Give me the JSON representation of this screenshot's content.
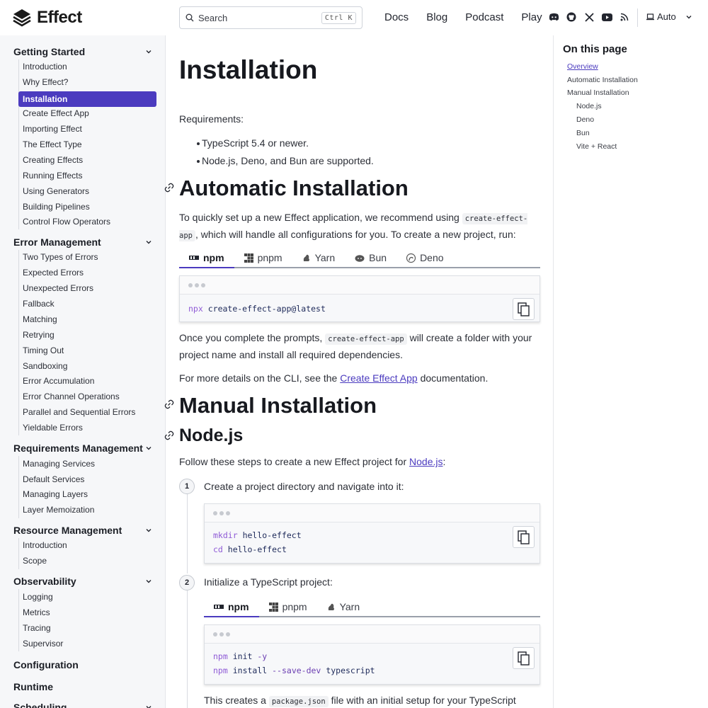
{
  "header": {
    "logo_text": "Effect",
    "search_placeholder": "Search",
    "search_shortcut": "Ctrl K",
    "nav": [
      "Docs",
      "Blog",
      "Podcast",
      "Play"
    ],
    "social_icons": [
      "discord-icon",
      "github-icon",
      "x-icon",
      "youtube-icon",
      "rss-icon"
    ],
    "theme_label": "Auto"
  },
  "sidebar": {
    "groups": [
      {
        "title": "Getting Started",
        "items": [
          "Introduction",
          "Why Effect?",
          "Installation",
          "Create Effect App",
          "Importing Effect",
          "The Effect Type",
          "Creating Effects",
          "Running Effects",
          "Using Generators",
          "Building Pipelines",
          "Control Flow Operators"
        ]
      },
      {
        "title": "Error Management",
        "items": [
          "Two Types of Errors",
          "Expected Errors",
          "Unexpected Errors",
          "Fallback",
          "Matching",
          "Retrying",
          "Timing Out",
          "Sandboxing",
          "Error Accumulation",
          "Error Channel Operations",
          "Parallel and Sequential Errors",
          "Yieldable Errors"
        ]
      },
      {
        "title": "Requirements Management",
        "items": [
          "Managing Services",
          "Default Services",
          "Managing Layers",
          "Layer Memoization"
        ]
      },
      {
        "title": "Resource Management",
        "items": [
          "Introduction",
          "Scope"
        ]
      },
      {
        "title": "Observability",
        "items": [
          "Logging",
          "Metrics",
          "Tracing",
          "Supervisor"
        ]
      },
      {
        "title": "Configuration",
        "items": []
      },
      {
        "title": "Runtime",
        "items": []
      },
      {
        "title": "Scheduling",
        "items": []
      }
    ],
    "active_item": "Installation"
  },
  "main": {
    "title": "Installation",
    "requirements_label": "Requirements:",
    "requirements": [
      "TypeScript 5.4 or newer.",
      "Node.js, Deno, and Bun are supported."
    ],
    "auto_heading": "Automatic Installation",
    "auto_p1_a": "To quickly set up a new Effect application, we recommend using",
    "auto_p1_code": "create-effect-app",
    "auto_p1_b": ",",
    "auto_p1_c": "which will handle all configurations for you. To create a new project, run:",
    "pm_tabs": [
      "npm",
      "pnpm",
      "Yarn",
      "Bun",
      "Deno"
    ],
    "pm_active": "npm",
    "auto_cmd_kw": "npx",
    "auto_cmd_arg": "create-effect-app@latest",
    "auto_p2_a": "Once you complete the prompts,",
    "auto_p2_code": "create-effect-app",
    "auto_p2_b": "will create a folder with your",
    "auto_p2_c": "project name and install all required dependencies.",
    "auto_p3_a": "For more details on the CLI, see the",
    "auto_p3_link": "Create Effect App",
    "auto_p3_b": "documentation.",
    "manual_heading": "Manual Installation",
    "node_heading": "Node.js",
    "node_p_a": "Follow these steps to create a new Effect project for",
    "node_p_link": "Node.js",
    "node_p_b": ":",
    "step1_num": "1",
    "step1_text": "Create a project directory and navigate into it:",
    "step1_line1_kw": "mkdir",
    "step1_line1_arg": "hello-effect",
    "step1_line2_kw": "cd",
    "step1_line2_arg": "hello-effect",
    "step2_num": "2",
    "step2_text": "Initialize a TypeScript project:",
    "step2_tabs": [
      "npm",
      "pnpm",
      "Yarn"
    ],
    "step2_line1_kw": "npm",
    "step2_line1_arg": "init",
    "step2_line1_flag": "-y",
    "step2_line2_kw": "npm",
    "step2_line2_arg": "install",
    "step2_line2_flag": "--save-dev",
    "step2_line2_arg2": "typescript",
    "step2_after_a": "This creates a",
    "step2_after_code": "package.json",
    "step2_after_b": "file with an initial setup for your TypeScript project."
  },
  "toc": {
    "title": "On this page",
    "items": [
      "Overview",
      "Automatic Installation",
      "Manual Installation",
      "Node.js",
      "Deno",
      "Bun",
      "Vite + React"
    ],
    "current": "Overview"
  },
  "colors": {
    "accent": "#4b3bbf",
    "sidebar_bg": "#f6f7f9"
  }
}
